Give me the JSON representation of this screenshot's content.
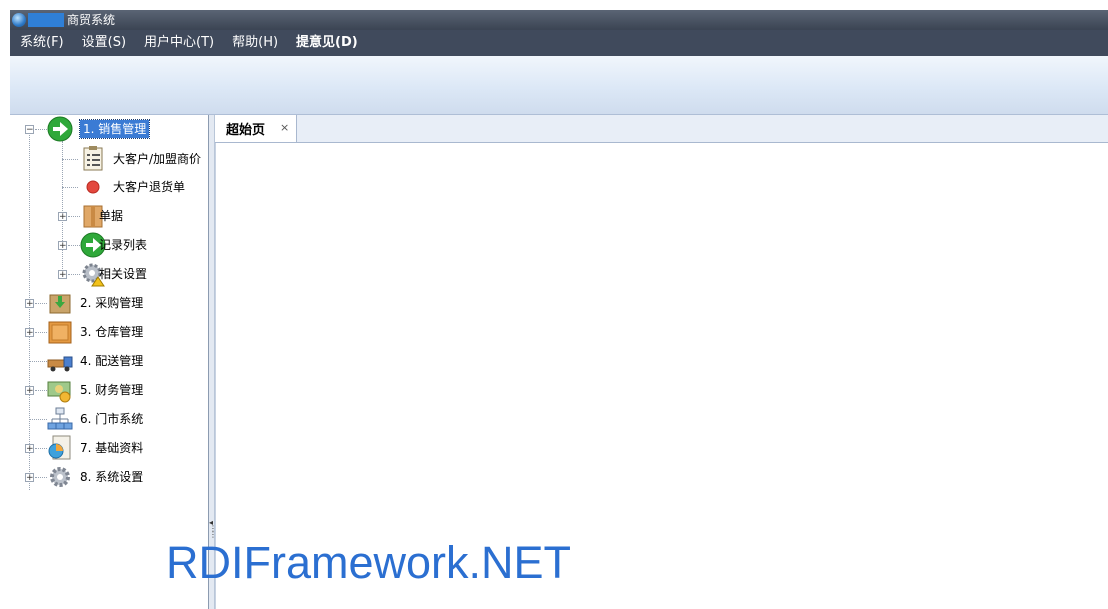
{
  "window": {
    "title": "商贸系统"
  },
  "menu": [
    {
      "label": "系统(F)",
      "bold": false
    },
    {
      "label": "设置(S)",
      "bold": false
    },
    {
      "label": "用户中心(T)",
      "bold": false
    },
    {
      "label": "帮助(H)",
      "bold": false
    },
    {
      "label": "提意见(D)",
      "bold": true
    }
  ],
  "tree": {
    "root": {
      "label": "1. 销售管理",
      "expanded": true,
      "selected": true,
      "icon": "green-arrow-icon"
    },
    "children": [
      {
        "label": "大客户/加盟商价",
        "icon": "clipboard-icon",
        "expander": false
      },
      {
        "label": "大客户退货单",
        "icon": "red-dot-icon",
        "expander": false
      },
      {
        "label": "单据",
        "icon": "box-icon",
        "expander": true
      },
      {
        "label": "记录列表",
        "icon": "green-arrow-icon",
        "expander": true
      },
      {
        "label": "相关设置",
        "icon": "gear-warning-icon",
        "expander": true
      }
    ],
    "modules": [
      {
        "label": "2. 采购管理",
        "icon": "package-arrow-icon"
      },
      {
        "label": "3. 仓库管理",
        "icon": "crate-icon"
      },
      {
        "label": "4. 配送管理",
        "icon": "truck-icon"
      },
      {
        "label": "5. 财务管理",
        "icon": "money-icon"
      },
      {
        "label": "6. 门市系统",
        "icon": "network-icon"
      },
      {
        "label": "7. 基础资料",
        "icon": "pie-doc-icon"
      },
      {
        "label": "8. 系统设置",
        "icon": "gear-icon"
      }
    ]
  },
  "tabs": [
    {
      "label": "超始页",
      "close": "×"
    }
  ],
  "watermark": "RDIFramework.NET",
  "colors": {
    "accent": "#3b7bd4",
    "menubar": "#404a5c",
    "watermark": "#2b6fd1"
  }
}
